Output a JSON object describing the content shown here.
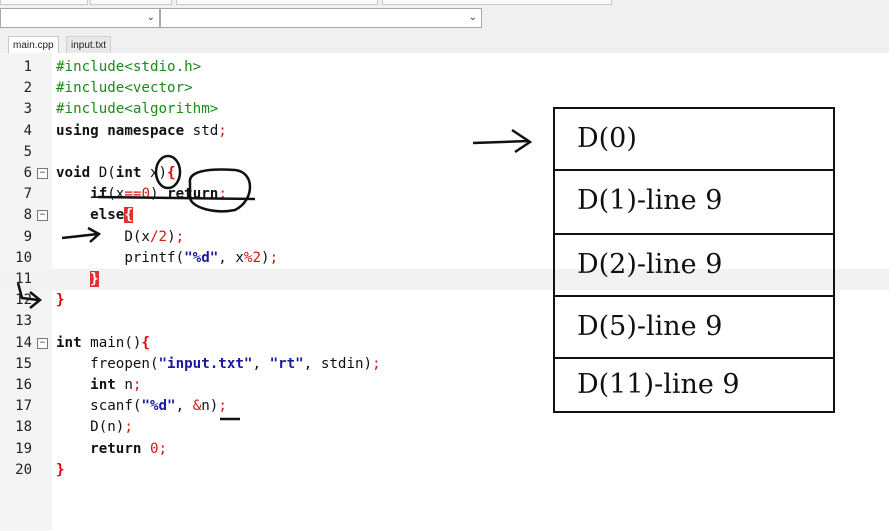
{
  "tabs": [
    {
      "label": "main.cpp",
      "active": true
    },
    {
      "label": "input.txt",
      "active": false
    }
  ],
  "code_lines": [
    {
      "num": "1",
      "html": "<span class=\"pp\">#include&lt;stdio.h&gt;</span>"
    },
    {
      "num": "2",
      "html": "<span class=\"pp\">#include&lt;vector&gt;</span>"
    },
    {
      "num": "3",
      "html": "<span class=\"pp\">#include&lt;algorithm&gt;</span>"
    },
    {
      "num": "4",
      "html": "<span class=\"kw\">using namespace</span> std<span class=\"op\">;</span>"
    },
    {
      "num": "5",
      "html": ""
    },
    {
      "num": "6",
      "html": "<span class=\"kw\">void</span> D(<span class=\"kw\">int</span> x)<span class=\"brace\">{</span>"
    },
    {
      "num": "7",
      "html": "    <span class=\"kw\">if</span>(x<span class=\"op\">==</span><span class=\"num\">0</span>) <span class=\"kw\">return</span><span class=\"op\">;</span>"
    },
    {
      "num": "8",
      "html": "    <span class=\"kw\">else</span><span class=\"bm\">{</span>"
    },
    {
      "num": "9",
      "html": "        D(x<span class=\"op\">/</span><span class=\"num\">2</span>)<span class=\"op\">;</span>"
    },
    {
      "num": "10",
      "html": "        printf(<span class=\"str\">\"%d\"</span>, x<span class=\"op\">%</span><span class=\"num\">2</span>)<span class=\"op\">;</span>"
    },
    {
      "num": "11",
      "html": "    <span class=\"bm\">}</span>"
    },
    {
      "num": "12",
      "html": "<span class=\"brace\">}</span>"
    },
    {
      "num": "13",
      "html": ""
    },
    {
      "num": "14",
      "html": "<span class=\"kw\">int</span> main()<span class=\"brace\">{</span>"
    },
    {
      "num": "15",
      "html": "    freopen(<span class=\"str\">\"input.txt\"</span>, <span class=\"str\">\"rt\"</span>, stdin)<span class=\"op\">;</span>"
    },
    {
      "num": "16",
      "html": "    <span class=\"kw\">int</span> n<span class=\"op\">;</span>"
    },
    {
      "num": "17",
      "html": "    scanf(<span class=\"str\">\"%d\"</span>, <span class=\"op\">&amp;</span>n)<span class=\"op\">;</span>"
    },
    {
      "num": "18",
      "html": "    D(n)<span class=\"op\">;</span>"
    },
    {
      "num": "19",
      "html": "    <span class=\"kw\">return</span> <span class=\"num\">0</span><span class=\"op\">;</span>"
    },
    {
      "num": "20",
      "html": "<span class=\"brace\">}</span>"
    }
  ],
  "folds": {
    "6": "⊟",
    "8": "⊟",
    "14": "⊟"
  },
  "current_line": "11",
  "stack_frames": [
    "D(0)",
    "D(1)-line 9",
    "D(2)-line 9",
    "D(5)-line 9",
    "D(11)-line 9"
  ],
  "colors": {
    "preprocessor": "#1a8a1a",
    "string": "#1a1aa0",
    "number": "#dd1111",
    "brace_mark": "#e03030"
  }
}
